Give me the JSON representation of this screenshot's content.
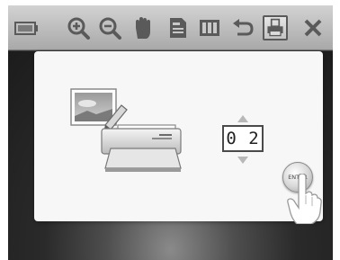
{
  "toolbar": {
    "icons": [
      "index-icon",
      "zoom-in-icon",
      "zoom-out-icon",
      "hand-pan-icon",
      "file-icon",
      "columns-icon",
      "return-icon",
      "print-icon",
      "close-icon"
    ],
    "selected": "print-icon"
  },
  "print_dialog": {
    "copies": "0 2",
    "enter_label": "ENTER"
  },
  "colors": {
    "toolbar_icon": "#5a5a5a",
    "dialog_background": "#f7f7f7"
  }
}
